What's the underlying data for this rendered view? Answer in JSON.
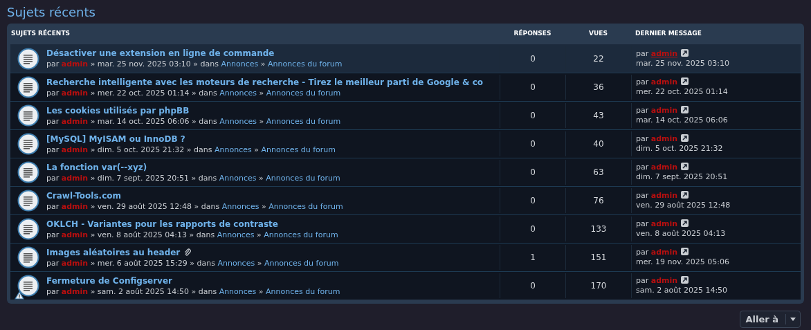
{
  "page_title": "Sujets récents",
  "table": {
    "columns": [
      "SUJETS RÉCENTS",
      "RÉPONSES",
      "VUES",
      "DERNIER MESSAGE"
    ],
    "rows": [
      {
        "title": "Désactiver une extension en ligne de commande",
        "by": "par",
        "author": "admin",
        "date": "» mar. 25 nov. 2025 03:10 » dans",
        "forum": "Annonces",
        "sep": "»",
        "subforum": "Annonces du forum",
        "replies": "0",
        "views": "22",
        "last_by": "par",
        "last_author": "admin",
        "last_date": "mar. 25 nov. 2025 03:10",
        "hovered": true,
        "attachment": false,
        "warning": false
      },
      {
        "title": "Recherche intelligente avec les moteurs de recherche - Tirez le meilleur parti de Google & co",
        "by": "par",
        "author": "admin",
        "date": "» mer. 22 oct. 2025 01:14 » dans",
        "forum": "Annonces",
        "sep": "»",
        "subforum": "Annonces du forum",
        "replies": "0",
        "views": "36",
        "last_by": "par",
        "last_author": "admin",
        "last_date": "mer. 22 oct. 2025 01:14",
        "hovered": false,
        "attachment": false,
        "warning": false
      },
      {
        "title": "Les cookies utilisés par phpBB",
        "by": "par",
        "author": "admin",
        "date": "» mar. 14 oct. 2025 06:06 » dans",
        "forum": "Annonces",
        "sep": "»",
        "subforum": "Annonces du forum",
        "replies": "0",
        "views": "43",
        "last_by": "par",
        "last_author": "admin",
        "last_date": "mar. 14 oct. 2025 06:06",
        "hovered": false,
        "attachment": false,
        "warning": false
      },
      {
        "title": "[MySQL] MyISAM ou InnoDB ?",
        "by": "par",
        "author": "admin",
        "date": "» dim. 5 oct. 2025 21:32 » dans",
        "forum": "Annonces",
        "sep": "»",
        "subforum": "Annonces du forum",
        "replies": "0",
        "views": "40",
        "last_by": "par",
        "last_author": "admin",
        "last_date": "dim. 5 oct. 2025 21:32",
        "hovered": false,
        "attachment": false,
        "warning": false
      },
      {
        "title": "La fonction var(--xyz)",
        "by": "par",
        "author": "admin",
        "date": "» dim. 7 sept. 2025 20:51 » dans",
        "forum": "Annonces",
        "sep": "»",
        "subforum": "Annonces du forum",
        "replies": "0",
        "views": "63",
        "last_by": "par",
        "last_author": "admin",
        "last_date": "dim. 7 sept. 2025 20:51",
        "hovered": false,
        "attachment": false,
        "warning": false
      },
      {
        "title": "Crawl-Tools.com",
        "by": "par",
        "author": "admin",
        "date": "» ven. 29 août 2025 12:48 » dans",
        "forum": "Annonces",
        "sep": "»",
        "subforum": "Annonces du forum",
        "replies": "0",
        "views": "76",
        "last_by": "par",
        "last_author": "admin",
        "last_date": "ven. 29 août 2025 12:48",
        "hovered": false,
        "attachment": false,
        "warning": false
      },
      {
        "title": "OKLCH - Variantes pour les rapports de contraste",
        "by": "par",
        "author": "admin",
        "date": "» ven. 8 août 2025 04:13 » dans",
        "forum": "Annonces",
        "sep": "»",
        "subforum": "Annonces du forum",
        "replies": "0",
        "views": "133",
        "last_by": "par",
        "last_author": "admin",
        "last_date": "ven. 8 août 2025 04:13",
        "hovered": false,
        "attachment": false,
        "warning": false
      },
      {
        "title": "Images aléatoires au header",
        "by": "par",
        "author": "admin",
        "date": "» mer. 6 août 2025 15:29 » dans",
        "forum": "Annonces",
        "sep": "»",
        "subforum": "Annonces du forum",
        "replies": "1",
        "views": "151",
        "last_by": "par",
        "last_author": "admin",
        "last_date": "mer. 19 nov. 2025 05:06",
        "hovered": false,
        "attachment": true,
        "warning": false
      },
      {
        "title": "Fermeture de Configserver",
        "by": "par",
        "author": "admin",
        "date": "» sam. 2 août 2025 14:50 » dans",
        "forum": "Annonces",
        "sep": "»",
        "subforum": "Annonces du forum",
        "replies": "0",
        "views": "170",
        "last_by": "par",
        "last_author": "admin",
        "last_date": "sam. 2 août 2025 14:50",
        "hovered": false,
        "attachment": false,
        "warning": true
      }
    ]
  },
  "jump_button": {
    "label": "Aller à"
  }
}
